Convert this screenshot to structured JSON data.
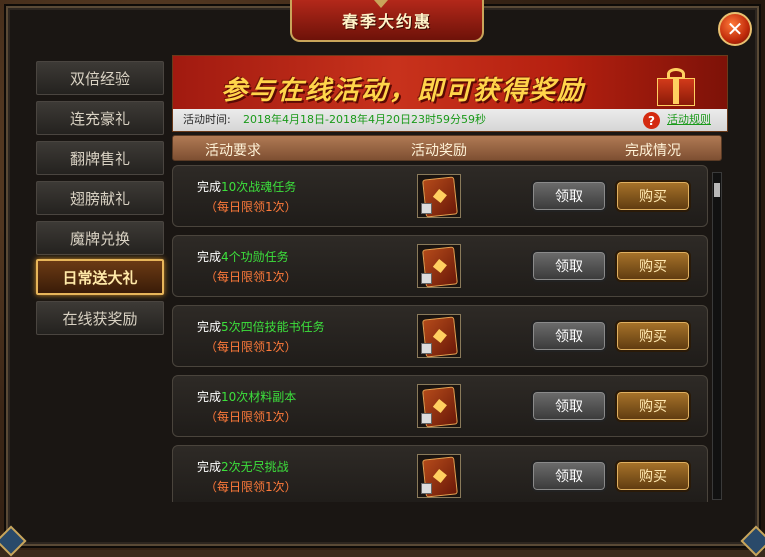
{
  "window": {
    "title": "春季大约惠",
    "close_symbol": "✕"
  },
  "sidebar": {
    "items": [
      {
        "label": "双倍经验",
        "active": false
      },
      {
        "label": "连充豪礼",
        "active": false
      },
      {
        "label": "翻牌售礼",
        "active": false
      },
      {
        "label": "翅膀献礼",
        "active": false
      },
      {
        "label": "魔牌兑换",
        "active": false
      },
      {
        "label": "日常送大礼",
        "active": true
      },
      {
        "label": "在线获奖励",
        "active": false
      }
    ]
  },
  "banner": {
    "slogan": "参与在线活动，即可获得奖励",
    "time_label": "活动时间:",
    "time_value": "2018年4月18日-2018年4月20日23时59分59秒",
    "rules_icon": "?",
    "rules_link": "活动规则"
  },
  "table": {
    "headers": {
      "requirement": "活动要求",
      "reward": "活动奖励",
      "status": "完成情况"
    },
    "rows": [
      {
        "prefix": "完成",
        "highlight": "10次战魂任务",
        "suffix": "",
        "limit": "（每日限领1次）",
        "claim": "领取",
        "buy": "购买"
      },
      {
        "prefix": "完成",
        "highlight": "4个功勋任务",
        "suffix": "",
        "limit": "（每日限领1次）",
        "claim": "领取",
        "buy": "购买"
      },
      {
        "prefix": "完成",
        "highlight": "5次四倍技能书任务",
        "suffix": "",
        "limit": "（每日限领1次）",
        "claim": "领取",
        "buy": "购买"
      },
      {
        "prefix": "完成",
        "highlight": "10次材料副本",
        "suffix": "",
        "limit": "（每日限领1次）",
        "claim": "领取",
        "buy": "购买"
      },
      {
        "prefix": "完成",
        "highlight": "2次无尽挑战",
        "suffix": "",
        "limit": "（每日限领1次）",
        "claim": "领取",
        "buy": "购买"
      }
    ]
  },
  "colors": {
    "highlight_green": "#3ce03c",
    "limit_orange": "#ff7a3a",
    "active_gold": "#e8b65a",
    "banner_red": "#c8321c"
  }
}
